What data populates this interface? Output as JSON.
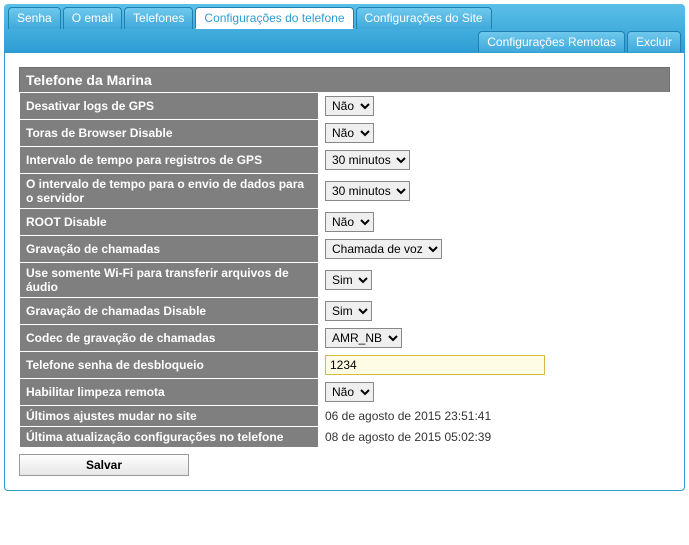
{
  "tabs": {
    "row1": [
      {
        "label": "Senha",
        "active": false
      },
      {
        "label": "O email",
        "active": false
      },
      {
        "label": "Telefones",
        "active": false
      },
      {
        "label": "Configurações do telefone",
        "active": true
      },
      {
        "label": "Configurações do Site",
        "active": false
      }
    ],
    "row2": [
      {
        "label": "Configurações Remotas",
        "active": false
      },
      {
        "label": "Excluir",
        "active": false
      }
    ]
  },
  "section_title": "Telefone da Marina",
  "rows": {
    "disable_gps_logs": {
      "label": "Desativar logs de GPS",
      "value": "Não"
    },
    "browser_logs_disable": {
      "label": "Toras de Browser Disable",
      "value": "Não"
    },
    "gps_interval": {
      "label": "Intervalo de tempo para registros de GPS",
      "value": "30 minutos"
    },
    "upload_interval": {
      "label": "O intervalo de tempo para o envio de dados para o servidor",
      "value": "30 minutos"
    },
    "root_disable": {
      "label": "ROOT Disable",
      "value": "Não"
    },
    "call_recording": {
      "label": "Gravação de chamadas",
      "value": "Chamada de voz"
    },
    "wifi_only": {
      "label": "Use somente Wi-Fi para transferir arquivos de áudio",
      "value": "Sim"
    },
    "call_recording_disable": {
      "label": "Gravação de chamadas Disable",
      "value": "Sim"
    },
    "codec": {
      "label": "Codec de gravação de chamadas",
      "value": "AMR_NB"
    },
    "unlock_pwd": {
      "label": "Telefone senha de desbloqueio",
      "value": "1234"
    },
    "remote_wipe": {
      "label": "Habilitar limpeza remota",
      "value": "Não"
    },
    "last_site_change": {
      "label": "Últimos ajustes mudar no site",
      "value": "06 de agosto de 2015 23:51:41"
    },
    "last_phone_update": {
      "label": "Última atualização configurações no telefone",
      "value": "08 de agosto de 2015 05:02:39"
    }
  },
  "save_label": "Salvar"
}
